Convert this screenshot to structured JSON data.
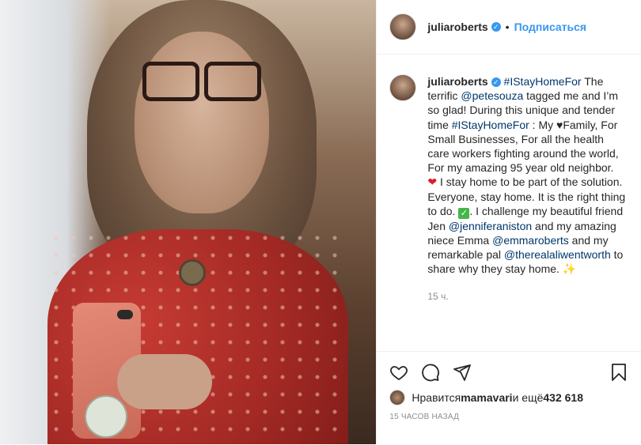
{
  "post": {
    "author": "juliaroberts",
    "follow_label": "Подписаться",
    "separator": "•",
    "caption": {
      "hashtag1": "#IStayHomeFor",
      "text1": " The terrific ",
      "mention1": "@petesouza",
      "text2": " tagged me and I’m so glad! During this unique and tender time ",
      "hashtag2": "#IStayHomeFor",
      "text3": " : My ",
      "heart_small": "♥",
      "text4": "Family, For Small Businesses, For all the health care workers fighting around the world, For my amazing 95 year old neighbor. ",
      "heart_red": "❤",
      "text5": " I stay home to be part of the solution. Everyone, stay home. It is the right thing to do. ",
      "checkmark": "✓",
      "text6": ". I challenge my beautiful friend Jen ",
      "mention2": "@jenniferaniston",
      "text7": " and my amazing niece Emma ",
      "mention3": "@emmaroberts",
      "text8": " and my remarkable pal ",
      "mention4": "@therealaliwentworth",
      "text9": " to share why they stay home. ",
      "sparkle": "✨"
    },
    "comment_time": "15 ч.",
    "likes": {
      "prefix": "Нравится ",
      "user": "mamavari",
      "middle": " и ещё ",
      "count": "432 618"
    },
    "post_time": "15 ЧАСОВ НАЗАД",
    "icons": {
      "like": "heart-outline-icon",
      "comment": "comment-icon",
      "share": "share-icon",
      "save": "bookmark-icon",
      "verified": "verified-badge-icon"
    }
  }
}
